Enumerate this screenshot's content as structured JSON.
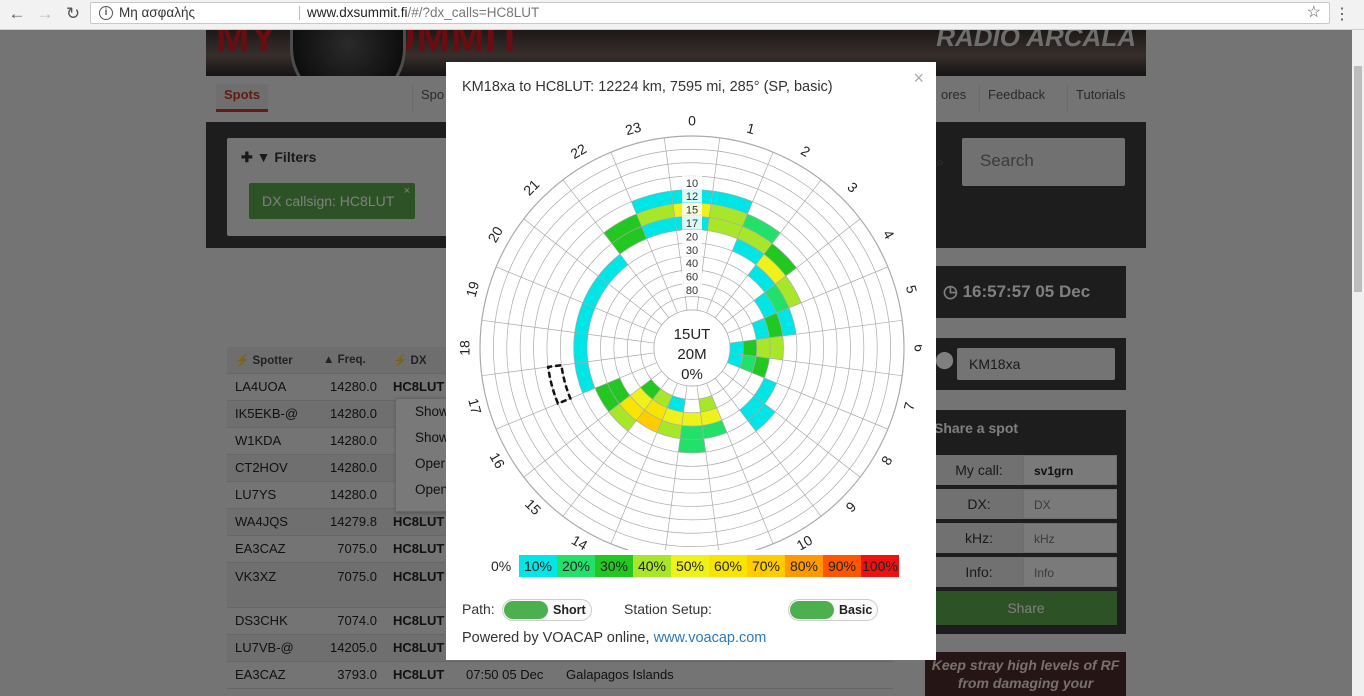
{
  "browser": {
    "secure_label": "Μη ασφαλής",
    "url_host": "www.dxsummit.fi",
    "url_path": "/#/?dx_calls=HC8LUT"
  },
  "page": {
    "tabs": [
      "Spots",
      "Spo",
      "ores",
      "Feedback",
      "Tutorials"
    ],
    "filters_label": "Filters",
    "filter_chip": "DX callsign: HC8LUT",
    "search_placeholder": "Search",
    "table": {
      "headers": [
        "Spotter",
        "Freq.",
        "DX"
      ],
      "rows": [
        [
          "LA4UOA",
          "14280.0",
          "HC8LUT",
          "",
          ""
        ],
        [
          "IK5EKB-@",
          "14280.0",
          "",
          "",
          ""
        ],
        [
          "W1KDA",
          "14280.0",
          "",
          "",
          ""
        ],
        [
          "CT2HOV",
          "14280.0",
          "",
          "",
          ""
        ],
        [
          "LU7YS",
          "14280.0",
          "",
          "",
          ""
        ],
        [
          "WA4JQS",
          "14279.8",
          "HC8LUT",
          "",
          ""
        ],
        [
          "EA3CAZ",
          "7075.0",
          "HC8LUT",
          "",
          ""
        ],
        [
          "VK3XZ",
          "7075.0",
          "HC8LUT",
          "",
          ""
        ],
        [
          "DS3CHK",
          "7074.0",
          "HC8LUT",
          "",
          ""
        ],
        [
          "LU7VB-@",
          "14205.0",
          "HC8LUT",
          "",
          ""
        ],
        [
          "EA3CAZ",
          "3793.0",
          "HC8LUT",
          "07:50 05 Dec",
          "Galapagos Islands"
        ]
      ]
    },
    "context_menu": [
      "Show",
      "Show",
      "Oper",
      "Open"
    ],
    "clock": "16:57:57 05 Dec",
    "locator": "KM18xa",
    "share": {
      "title": "Share a spot",
      "my_call_label": "My call:",
      "my_call_value": "sv1grn",
      "dx_label": "DX:",
      "dx_placeholder": "DX",
      "khz_label": "kHz:",
      "khz_placeholder": "kHz",
      "info_label": "Info:",
      "info_placeholder": "Info",
      "button": "Share"
    },
    "ad_text": "Keep stray high levels of RF from damaging your"
  },
  "modal": {
    "title": "KM18xa to HC8LUT: 12224 km, 7595 mi, 285° (SP, basic)",
    "close": "×",
    "center_lines": [
      "15UT",
      "20M",
      "0%"
    ],
    "hours": [
      "0",
      "1",
      "2",
      "3",
      "4",
      "5",
      "6",
      "7",
      "8",
      "9",
      "10",
      "11",
      "12",
      "13",
      "14",
      "15",
      "16",
      "17",
      "18",
      "19",
      "20",
      "21",
      "22",
      "23"
    ],
    "bands": [
      "10",
      "12",
      "15",
      "17",
      "20",
      "30",
      "40",
      "60",
      "80"
    ],
    "legend": {
      "zero": "0%",
      "items": [
        {
          "label": "10%",
          "color": "#00e5e5"
        },
        {
          "label": "20%",
          "color": "#22e06a"
        },
        {
          "label": "30%",
          "color": "#22c722"
        },
        {
          "label": "40%",
          "color": "#a8e62a"
        },
        {
          "label": "50%",
          "color": "#eef21a"
        },
        {
          "label": "60%",
          "color": "#f7e500"
        },
        {
          "label": "70%",
          "color": "#ffcc00"
        },
        {
          "label": "80%",
          "color": "#ff9900"
        },
        {
          "label": "90%",
          "color": "#ff5500"
        },
        {
          "label": "100%",
          "color": "#ee1111"
        }
      ]
    },
    "path_label": "Path:",
    "path_value": "Short",
    "station_label": "Station Setup:",
    "station_value": "Basic",
    "powered_text": "Powered by VOACAP online,",
    "powered_link": "www.voacap.com",
    "selected_hour": "15",
    "cells": [
      {
        "hour": 0,
        "band": 4,
        "v": 1
      },
      {
        "hour": 23,
        "band": 4,
        "v": 1
      },
      {
        "hour": 1,
        "band": 4,
        "v": 1
      },
      {
        "hour": 0,
        "band": 5,
        "v": 5
      },
      {
        "hour": 23,
        "band": 5,
        "v": 4
      },
      {
        "hour": 1,
        "band": 5,
        "v": 4
      },
      {
        "hour": 2,
        "band": 5,
        "v": 2
      },
      {
        "hour": 22,
        "band": 5,
        "v": 3
      },
      {
        "hour": 0,
        "band": 6,
        "v": 1
      },
      {
        "hour": 23,
        "band": 6,
        "v": 1
      },
      {
        "hour": 1,
        "band": 6,
        "v": 4
      },
      {
        "hour": 2,
        "band": 6,
        "v": 4
      },
      {
        "hour": 22,
        "band": 6,
        "v": 3
      },
      {
        "hour": 3,
        "band": 6,
        "v": 3
      },
      {
        "hour": 2,
        "band": 7,
        "v": 1
      },
      {
        "hour": 3,
        "band": 7,
        "v": 5
      },
      {
        "hour": 4,
        "band": 7,
        "v": 4
      },
      {
        "hour": 21,
        "band": 7,
        "v": 1
      },
      {
        "hour": 20,
        "band": 7,
        "v": 1
      },
      {
        "hour": 19,
        "band": 7,
        "v": 1
      },
      {
        "hour": 3,
        "band": 8,
        "v": 1
      },
      {
        "hour": 4,
        "band": 8,
        "v": 2
      },
      {
        "hour": 5,
        "band": 8,
        "v": 1
      },
      {
        "hour": 4,
        "band": 9,
        "v": 1
      },
      {
        "hour": 5,
        "band": 9,
        "v": 3
      },
      {
        "hour": 6,
        "band": 9,
        "v": 4
      },
      {
        "hour": 5,
        "band": 10,
        "v": 1
      },
      {
        "hour": 6,
        "band": 10,
        "v": 4
      },
      {
        "hour": 7,
        "band": 10,
        "v": 3
      },
      {
        "hour": 6,
        "band": 11,
        "v": 3
      },
      {
        "hour": 7,
        "band": 11,
        "v": 2
      },
      {
        "hour": 6,
        "band": 12,
        "v": 1
      },
      {
        "hour": 7,
        "band": 12,
        "v": 1
      },
      {
        "hour": 8,
        "band": 9,
        "v": 1
      },
      {
        "hour": 9,
        "band": 9,
        "v": 1
      },
      {
        "hour": 9,
        "band": 8,
        "v": 1
      },
      {
        "hour": 11,
        "band": 9,
        "v": 2
      },
      {
        "hour": 11,
        "band": 10,
        "v": 5
      },
      {
        "hour": 12,
        "band": 10,
        "v": 5
      },
      {
        "hour": 12,
        "band": 9,
        "v": 2
      },
      {
        "hour": 11,
        "band": 11,
        "v": 4
      },
      {
        "hour": 13,
        "band": 9,
        "v": 4
      },
      {
        "hour": 13,
        "band": 10,
        "v": 5
      },
      {
        "hour": 13,
        "band": 11,
        "v": 1
      },
      {
        "hour": 12,
        "band": 8,
        "v": 2
      },
      {
        "hour": 14,
        "band": 9,
        "v": 7
      },
      {
        "hour": 14,
        "band": 10,
        "v": 6
      },
      {
        "hour": 14,
        "band": 11,
        "v": 4
      },
      {
        "hour": 15,
        "band": 8,
        "v": 4
      },
      {
        "hour": 15,
        "band": 9,
        "v": 6
      },
      {
        "hour": 15,
        "band": 10,
        "v": 5
      },
      {
        "hour": 15,
        "band": 11,
        "v": 3
      },
      {
        "hour": 16,
        "band": 8,
        "v": 3
      },
      {
        "hour": 16,
        "band": 9,
        "v": 3
      },
      {
        "hour": 17,
        "band": 7,
        "v": 1
      },
      {
        "hour": 18,
        "band": 7,
        "v": 1
      }
    ]
  }
}
